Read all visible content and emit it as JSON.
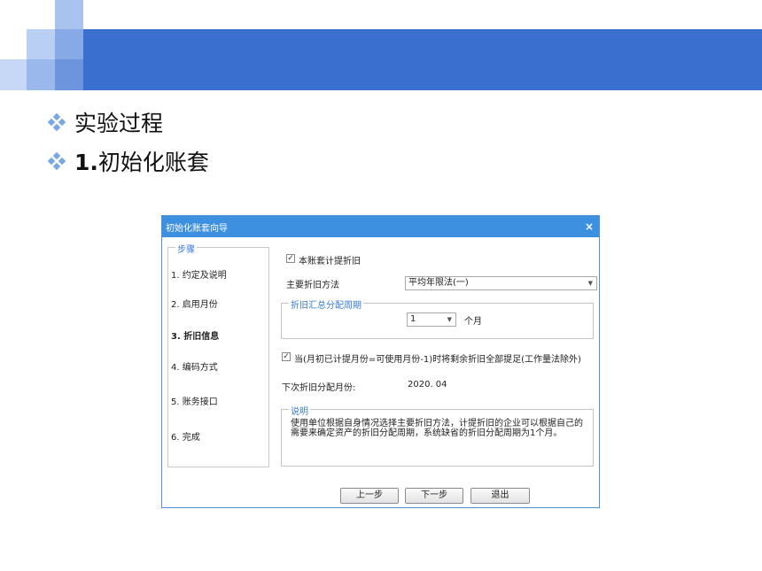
{
  "bullets": [
    "实验过程",
    "1.初始化账套"
  ],
  "dialog": {
    "title": "初始化账套向导",
    "close_glyph": "×",
    "steps_legend": "步骤",
    "steps": [
      "1. 约定及说明",
      "2. 启用月份",
      "3. 折旧信息",
      "4. 编码方式",
      "5. 账务接口",
      "6. 完成"
    ],
    "active_step_index": 2,
    "depreciation_checkbox_label": "本账套计提折旧",
    "depreciation_checked": true,
    "method_label": "主要折旧方法",
    "method_value": "平均年限法(一)",
    "period_legend": "折旧汇总分配周期",
    "period_value": "1",
    "period_unit": "个月",
    "remaining_checkbox_label": "当(月初已计提月份=可使用月份-1)时将剩余折旧全部提足(工作量法除外)",
    "remaining_checked": true,
    "next_alloc_label": "下次折旧分配月份:",
    "next_alloc_value": "2020. 04",
    "desc_legend": "说明",
    "desc_text": "使用单位根据自身情况选择主要折旧方法，计提折旧的企业可以根据自己的需要来确定资产的折旧分配周期，系统缺省的折旧分配周期为1个月。",
    "buttons": {
      "prev": "上一步",
      "next": "下一步",
      "exit": "退出"
    }
  },
  "colors": {
    "header_bar": "#3a6fd0",
    "dialog_title": "#3d8fe0",
    "legend_text": "#3a7bd5"
  }
}
